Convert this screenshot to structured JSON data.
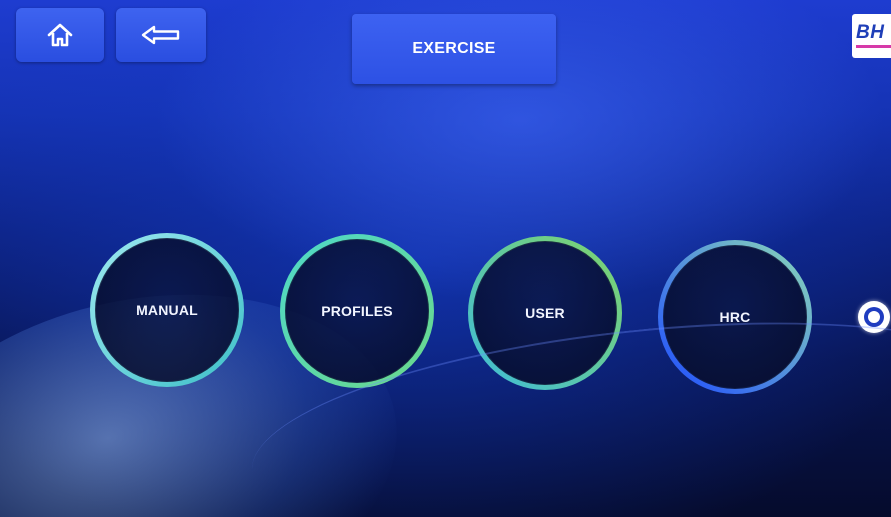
{
  "header": {
    "home_icon": "home-icon",
    "back_icon": "arrow-left-icon",
    "active_tab_label": "EXERCISE",
    "brand_logo_text": "BH",
    "brand_colors": {
      "text": "#1f3fb8",
      "underline": "#d63aa8"
    }
  },
  "modes": [
    {
      "label": "MANUAL",
      "ring_colors": [
        "#9ce8f0",
        "#3fc0c8"
      ]
    },
    {
      "label": "PROFILES",
      "ring_colors": [
        "#4fd8c8",
        "#6ad88c"
      ]
    },
    {
      "label": "USER",
      "ring_colors": [
        "#3fbcd8",
        "#7fd46c"
      ]
    },
    {
      "label": "HRC",
      "ring_colors": [
        "#8ad8b8",
        "#1f4cff"
      ]
    }
  ],
  "pager": {
    "icon": "page-indicator-dot"
  },
  "colors": {
    "button_blue": "#3e63f0",
    "background_top": "#1e3cd0",
    "background_bottom": "#050b2c"
  }
}
